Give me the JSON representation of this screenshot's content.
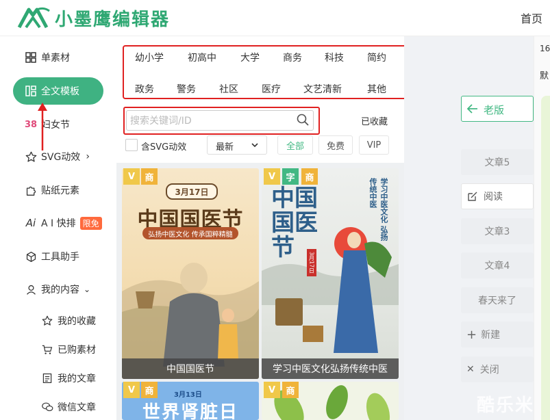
{
  "header": {
    "logo_text": "小墨鹰编辑器",
    "home": "首页"
  },
  "sidebar": {
    "items": [
      {
        "label": "单素材"
      },
      {
        "label": "全文模板"
      },
      {
        "label": "妇女节"
      },
      {
        "label": "SVG动效"
      },
      {
        "label": "贴纸元素"
      },
      {
        "label": "A I 快排",
        "badge": "限免"
      },
      {
        "label": "工具助手"
      },
      {
        "label": "我的内容"
      }
    ],
    "sub_items": [
      {
        "label": "我的收藏"
      },
      {
        "label": "已购素材"
      },
      {
        "label": "我的文章"
      },
      {
        "label": "微信文章"
      }
    ]
  },
  "categories": {
    "row1": [
      "幼小学",
      "初高中",
      "大学",
      "商务",
      "科技",
      "简约"
    ],
    "row2": [
      "政务",
      "警务",
      "社区",
      "医疗",
      "文艺清新",
      "其他"
    ]
  },
  "search": {
    "placeholder": "搜索关键词/ID",
    "collected": "已收藏"
  },
  "filters": {
    "svg_checkbox_label": "含SVG动效",
    "sort_value": "最新",
    "chips": [
      "全部",
      "免费",
      "VIP"
    ]
  },
  "templates": [
    {
      "caption": "中国国医节",
      "tags": [
        "V",
        "商"
      ],
      "date": "3月17日",
      "headline": "中国国医节",
      "subtitle": "弘扬中医文化 传承国粹精髓"
    },
    {
      "caption": "学习中医文化弘扬传统中医",
      "tags": [
        "V",
        "字",
        "商"
      ],
      "headline": "中国国医节",
      "date": "3月17日",
      "side_text": "学习中医文化 弘扬传统中医"
    },
    {
      "caption": "",
      "tags": [
        "V",
        "商"
      ],
      "date": "3月13日",
      "headline": "世界肾脏日"
    },
    {
      "caption": "",
      "tags": [
        "V",
        "商"
      ]
    }
  ],
  "right_panel": {
    "back": "老版",
    "buttons": [
      "文章5",
      "阅读",
      "文章3",
      "文章4",
      "春天来了",
      "新建",
      "关闭"
    ],
    "far_texts": [
      "16",
      "默"
    ],
    "watermark": "酷乐米"
  },
  "colors": {
    "brand": "#3fb282",
    "highlight_red": "#e02020",
    "badge": "#ff6a3d"
  }
}
